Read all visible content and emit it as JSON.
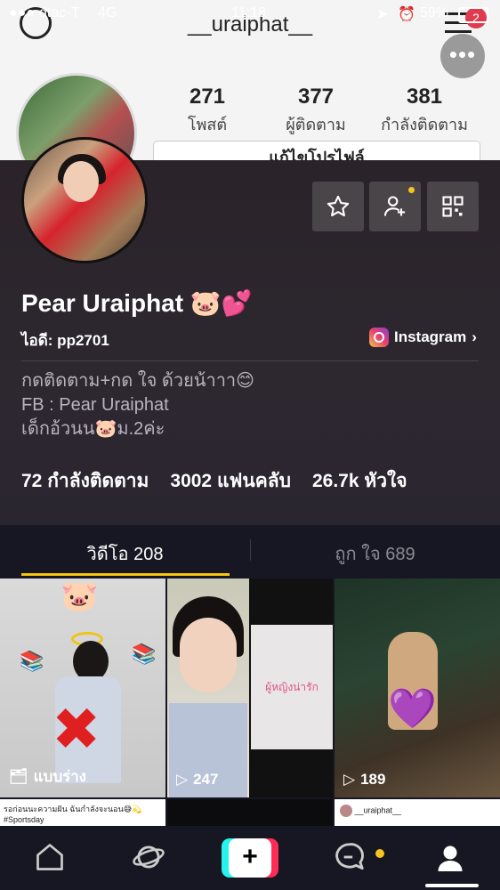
{
  "status": {
    "carrier": "dtac-T",
    "network": "4G",
    "time": "11:18",
    "battery": "59%"
  },
  "ig": {
    "username": "__uraiphat__",
    "menu_badge": "2",
    "stats": [
      {
        "value": "271",
        "label": "โพสต์"
      },
      {
        "value": "377",
        "label": "ผู้ติดตาม"
      },
      {
        "value": "381",
        "label": "กำลังติดตาม"
      }
    ],
    "edit_profile": "แก้ไขโปรไฟล์"
  },
  "profile": {
    "name": "Pear Uraiphat 🐷💕",
    "uid": "ไอดี: pp2701",
    "instagram_label": "Instagram",
    "bio": [
      "กดติดตาม+กด ใจ ด้วยน้าาา😊",
      "FB : Pear Uraiphat",
      "เด็กอ้วนน🐷ม.2ค่ะ"
    ],
    "following": {
      "value": "72",
      "label": "กำลังติดตาม"
    },
    "fans": {
      "value": "3002",
      "label": "แฟนคลับ"
    },
    "likes": {
      "value": "26.7k",
      "label": "หัวใจ"
    }
  },
  "tabs": [
    {
      "label": "วิดีโอ 208"
    },
    {
      "label": "ถูก ใจ 689"
    }
  ],
  "videos": [
    {
      "label": "แบบร่าง",
      "icon": "draft-icon"
    },
    {
      "label": "247",
      "icon": "play-icon",
      "overlay_text": "ผู้หญิงน่ารัก"
    },
    {
      "label": "189",
      "icon": "play-icon"
    }
  ],
  "row2": {
    "left_caption": "รอก่อนนะความฝัน ฉันกำลังจะนอน😅💫",
    "left_tag": "#Sportsday",
    "right_user": "__uraiphat__"
  },
  "colors": {
    "accent": "#f5c60f",
    "card_bg": "#2a2329",
    "page_bg": "#161722"
  }
}
